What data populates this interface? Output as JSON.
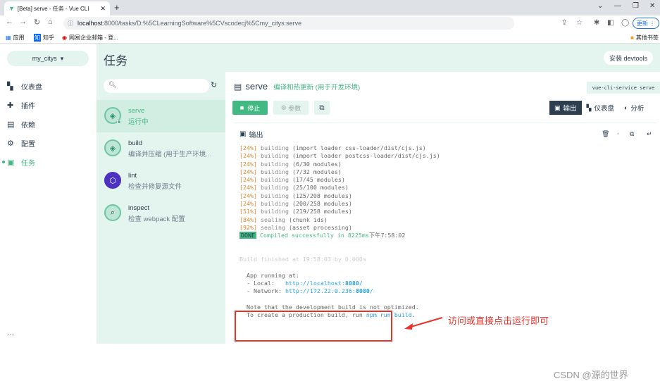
{
  "browser": {
    "tab_title": "[Beta] serve - 任务 - Vue CLI",
    "tab_close": "✕",
    "new_tab": "+",
    "url_host": "localhost",
    "url_path": ":8000/tasks/D:%5CLearningSoftware%5CVscodecj%5Cmy_citys:serve",
    "update_label": "更新",
    "bookmarks": [
      {
        "label": "应用"
      },
      {
        "label": "知乎"
      },
      {
        "label": "网易企业邮箱 - 登..."
      }
    ],
    "other_bookmarks": "其他书签"
  },
  "nav": {
    "project": "my_citys",
    "items": [
      {
        "label": "仪表盘"
      },
      {
        "label": "插件"
      },
      {
        "label": "依赖"
      },
      {
        "label": "配置"
      },
      {
        "label": "任务"
      }
    ],
    "more": "···"
  },
  "header": {
    "title": "任务",
    "devtools": "安装 devtools"
  },
  "tasks": [
    {
      "name": "serve",
      "desc": "运行中"
    },
    {
      "name": "build",
      "desc": "编译并压缩 (用于生产环境..."
    },
    {
      "name": "lint",
      "desc": "检查并修复源文件"
    },
    {
      "name": "inspect",
      "desc": "检查 webpack 配置"
    }
  ],
  "detail": {
    "name": "serve",
    "desc": "编译和热更新 (用于开发环境)",
    "command": "vue-cli-service serve",
    "stop": "停止",
    "params": "参数",
    "tabs": [
      {
        "label": "输出"
      },
      {
        "label": "仪表盘"
      },
      {
        "label": "分析"
      }
    ],
    "output_title": "输出"
  },
  "log": {
    "progress": [
      {
        "pct": "[24%]",
        "word": "building",
        "text": " (import loader css-loader/dist/cjs.js)"
      },
      {
        "pct": "[24%]",
        "word": "building",
        "text": " (import loader postcss-loader/dist/cjs.js)"
      },
      {
        "pct": "[24%]",
        "word": "building",
        "text": " (6/30 modules)"
      },
      {
        "pct": "[24%]",
        "word": "building",
        "text": " (7/32 modules)"
      },
      {
        "pct": "[24%]",
        "word": "building",
        "text": " (17/45 modules)"
      },
      {
        "pct": "[24%]",
        "word": "building",
        "text": " (25/100 modules)"
      },
      {
        "pct": "[24%]",
        "word": "building",
        "text": " (125/208 modules)"
      },
      {
        "pct": "[24%]",
        "word": "building",
        "text": " (200/258 modules)"
      },
      {
        "pct": "[51%]",
        "word": "building",
        "text": " (219/258 modules)"
      },
      {
        "pct": "[84%]",
        "word": "sealing",
        "text": " (chunk ids)"
      },
      {
        "pct": "[92%]",
        "word": "sealing",
        "text": " (asset processing)"
      }
    ],
    "done_badge": "DONE",
    "compiled": " Compiled successfully in 8225ms",
    "compiled_time": "下午7:58:02",
    "build_finished": "Build finished at 19:58:03 by 0.000s",
    "app_running": "  App running at:",
    "local_label": "  - Local:   ",
    "local_url": "http://localhost:",
    "local_port": "8080",
    "network_label": "  - Network: ",
    "network_url": "http://172.22.0.236:",
    "network_port": "8080",
    "slash": "/",
    "note1": "  Note that the development build is not optimized.",
    "note2_pre": "  To create a production build, run ",
    "note2_cmd": "npm run build",
    "note2_post": "."
  },
  "annotation": "访问或直接点击运行即可",
  "watermark": "CSDN @源的世界"
}
